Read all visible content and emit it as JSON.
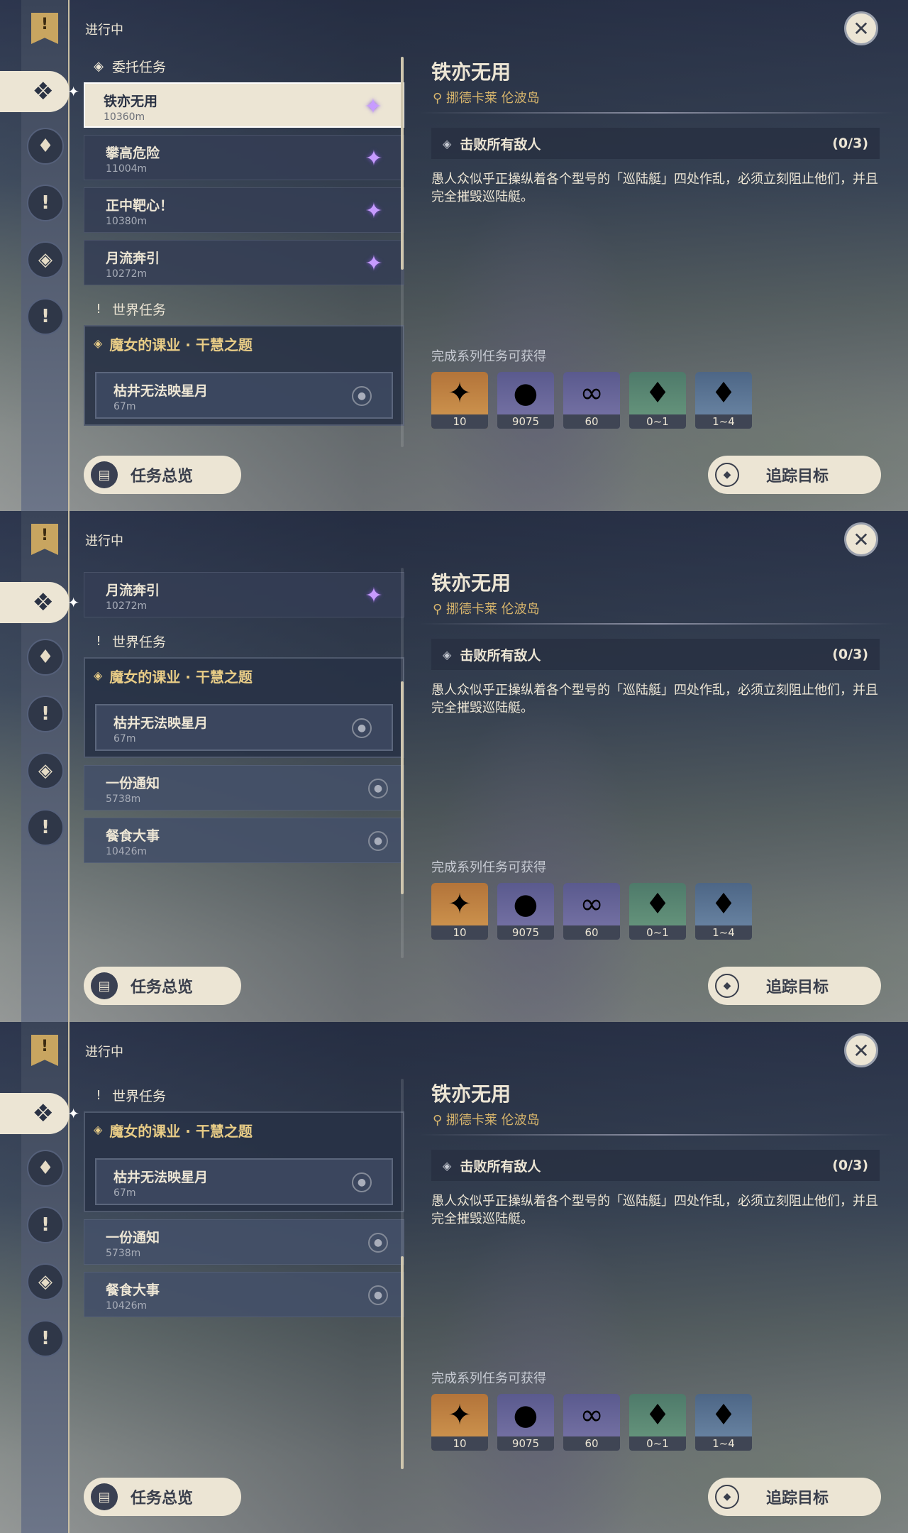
{
  "ui": {
    "in_progress": "进行中",
    "overview_label": "任务总览",
    "track_label": "追踪目标"
  },
  "sections": {
    "commission": "委托任务",
    "world": "世界任务"
  },
  "commissions": [
    {
      "name": "铁亦无用",
      "dist": "10360m"
    },
    {
      "name": "攀高危险",
      "dist": "11004m"
    },
    {
      "name": "正中靶心！",
      "dist": "10380m"
    },
    {
      "name": "月流奔引",
      "dist": "10272m"
    }
  ],
  "world_group": {
    "title": "魔女的课业 · 干慧之题",
    "sub": {
      "name": "枯井无法映星月",
      "dist": "67m"
    }
  },
  "world_items": [
    {
      "name": "一份通知",
      "dist": "5738m"
    },
    {
      "name": "餐食大事",
      "dist": "10426m"
    }
  ],
  "detail": {
    "title": "铁亦无用",
    "location": "挪德卡莱 伦波岛",
    "objective": "击败所有敌人",
    "progress": "(0/3)",
    "description": "愚人众似乎正操纵着各个型号的「巡陆艇」四处作乱，必须立刻阻止他们，并且完全摧毁巡陆艇。",
    "rewards_title": "完成系列任务可获得",
    "rewards": [
      {
        "icon": "primogem-icon",
        "qty": "10",
        "color": "#c8884a"
      },
      {
        "icon": "mora-icon",
        "qty": "9075",
        "color": "#6c6c9c"
      },
      {
        "icon": "companionship-exp-icon",
        "qty": "60",
        "color": "#6c6c9c"
      },
      {
        "icon": "crystal-chunk-icon",
        "qty": "0~1",
        "color": "#5c8a74"
      },
      {
        "icon": "crystal-cluster-icon",
        "qty": "1~4",
        "color": "#5e7896"
      }
    ]
  },
  "frames": [
    {
      "scroll_state": "top"
    },
    {
      "scroll_state": "middle"
    },
    {
      "scroll_state": "bottom"
    }
  ]
}
